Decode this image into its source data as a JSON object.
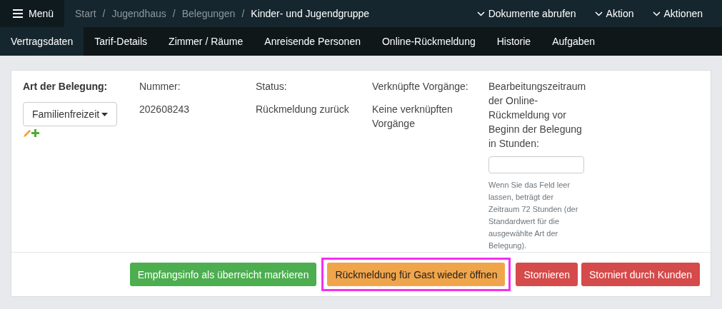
{
  "menu_button": {
    "label": "Menü"
  },
  "breadcrumbs": [
    {
      "label": "Start",
      "current": false
    },
    {
      "label": "Jugendhaus",
      "current": false
    },
    {
      "label": "Belegungen",
      "current": false
    },
    {
      "label": "Kinder- und Jugendgruppe",
      "current": true
    }
  ],
  "breadcrumb_separator": "/",
  "top_actions": [
    "Dokumente abrufen",
    "Aktion",
    "Aktionen"
  ],
  "tabs": [
    {
      "label": "Vertragsdaten",
      "selected": true
    },
    {
      "label": "Tarif-Details",
      "selected": false
    },
    {
      "label": "Zimmer / Räume",
      "selected": false
    },
    {
      "label": "Anreisende Personen",
      "selected": false
    },
    {
      "label": "Online-Rückmeldung",
      "selected": false
    },
    {
      "label": "Historie",
      "selected": false
    },
    {
      "label": "Aufgaben",
      "selected": false
    }
  ],
  "fields": [
    {
      "kind": "select",
      "label": "Art der Belegung:",
      "value": "Familienfreizeit"
    },
    {
      "kind": "text",
      "label": "Nummer:",
      "value": "202608243"
    },
    {
      "kind": "text",
      "label": "Status:",
      "value": "Rückmeldung zurück"
    },
    {
      "kind": "text",
      "label": "Verknüpfte Vorgänge:",
      "value": "Keine verknüpften Vorgänge"
    },
    {
      "kind": "input",
      "label": "Bearbeitungszeitraum der Online-Rückmeldung vor Beginn der Belegung in Stunden:",
      "help": "Wenn Sie das Feld leer lassen, beträgt der Zeitraum 72 Stunden (der Standardwert für die ausgewählte Art der Belegung)."
    }
  ],
  "buttons": [
    {
      "label": "Empfangsinfo als überreicht markieren",
      "kind": "success",
      "highlighted": false
    },
    {
      "label": "Rückmeldung für Gast wieder öffnen",
      "kind": "warning",
      "highlighted": true
    },
    {
      "label": "Stornieren",
      "kind": "danger",
      "highlighted": false
    },
    {
      "label": "Storniert durch Kunden",
      "kind": "danger",
      "highlighted": false
    }
  ]
}
